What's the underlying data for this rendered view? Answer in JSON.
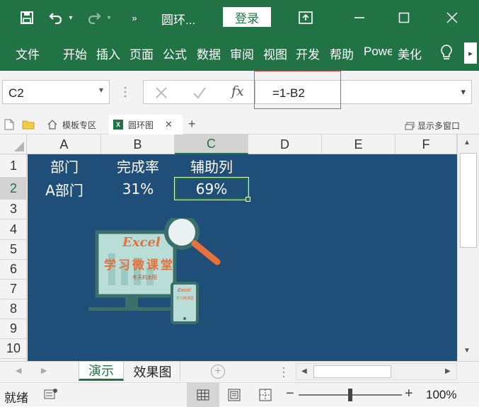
{
  "app": {
    "doc_title": "圆环...",
    "login_label": "登录"
  },
  "ribbon": {
    "tabs": [
      "文件",
      "开始",
      "插入",
      "页面",
      "公式",
      "数据",
      "审阅",
      "视图",
      "开发",
      "帮助",
      "Powe",
      "美化"
    ]
  },
  "formula_bar": {
    "name_box": "C2",
    "formula": "=1-B2",
    "fx_label": "fx"
  },
  "workbook_tabs": [
    {
      "label": "模板专区",
      "active": false
    },
    {
      "label": "圆环图",
      "active": true
    }
  ],
  "show_multi_window": "显示多窗口",
  "columns": [
    "A",
    "B",
    "C",
    "D",
    "E",
    "F"
  ],
  "rows": [
    "1",
    "2",
    "3",
    "4",
    "5",
    "6",
    "7",
    "8",
    "9",
    "10"
  ],
  "cells": {
    "A1": "部门",
    "B1": "完成率",
    "C1": "辅助列",
    "A2": "A部门",
    "B2": "31%",
    "C2": "69%"
  },
  "image": {
    "title": "Excel",
    "subtitle": "学习微课堂",
    "tagline": "冬天的太阳",
    "tablet_title": "Excel",
    "tablet_sub": "学习微课堂"
  },
  "sheet_tabs": [
    {
      "label": "演示",
      "active": true
    },
    {
      "label": "效果图",
      "active": false
    }
  ],
  "status": {
    "ready": "就绪",
    "zoom": "100%"
  },
  "colors": {
    "brand_green": "#217346",
    "sheet_fill": "#1f4e79",
    "accent_orange": "#e8703a"
  }
}
